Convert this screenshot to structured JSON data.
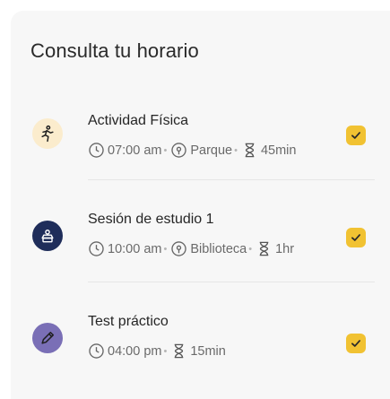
{
  "title": "Consulta tu horario",
  "items": [
    {
      "title": "Actividad Física",
      "time": "07:00 am",
      "location": "Parque",
      "duration": "45min",
      "avatar_color": "#fbeccd",
      "icon": "runner-icon",
      "checked": true
    },
    {
      "title": "Sesión de estudio 1",
      "time": "10:00 am",
      "location": "Biblioteca",
      "duration": "1hr",
      "avatar_color": "#1f2d5a",
      "icon": "study-group-icon",
      "checked": true
    },
    {
      "title": "Test práctico",
      "time": "04:00 pm",
      "duration": "15min",
      "avatar_color": "#7a6fb6",
      "icon": "pencil-icon",
      "checked": true
    }
  ],
  "colors": {
    "checkbox": "#f1c232",
    "card_bg": "#f7f7f7"
  }
}
